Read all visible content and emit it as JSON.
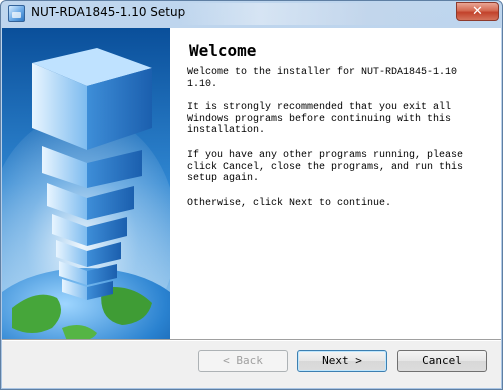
{
  "window": {
    "title": "NUT-RDA1845-1.10 Setup",
    "close_glyph": "✕"
  },
  "welcome": {
    "heading": "Welcome",
    "paragraphs": [
      "Welcome to the installer for NUT-RDA1845-1.10\n1.10.",
      "It is strongly recommended that you exit all\nWindows programs before continuing with this\ninstallation.",
      "If you have any other programs running, please\nclick Cancel, close the programs, and run this\nsetup again.",
      "Otherwise, click Next to continue."
    ]
  },
  "buttons": {
    "back": {
      "label": "< Back",
      "enabled": false
    },
    "next": {
      "label": "Next >",
      "enabled": true
    },
    "cancel": {
      "label": "Cancel",
      "enabled": true
    }
  },
  "icons": {
    "app": "installer-app-icon",
    "side": "stacked-cubes-globe-illustration"
  }
}
